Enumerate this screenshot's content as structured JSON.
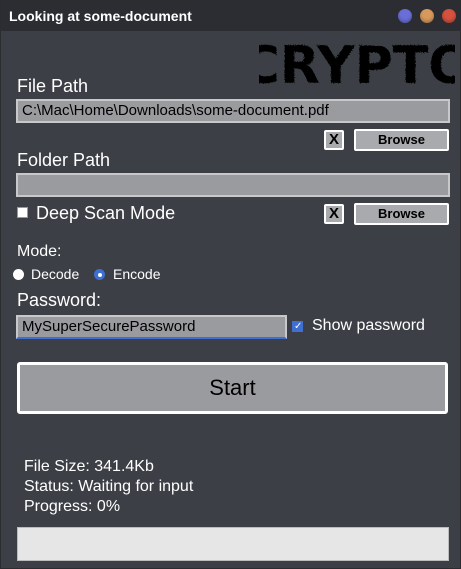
{
  "window": {
    "title": "Looking at some-document"
  },
  "logo": {
    "text": "CRYPTO"
  },
  "file_path": {
    "label": "File Path",
    "value": "C:\\Mac\\Home\\Downloads\\some-document.pdf",
    "clear_label": "X",
    "browse_label": "Browse"
  },
  "folder_path": {
    "label": "Folder Path",
    "value": "",
    "clear_label": "X",
    "browse_label": "Browse"
  },
  "deep_scan": {
    "label": "Deep Scan Mode",
    "checked": false
  },
  "mode": {
    "label": "Mode:",
    "options": [
      "Decode",
      "Encode"
    ],
    "selected": "Encode"
  },
  "password": {
    "label": "Password:",
    "value": "MySuperSecurePassword",
    "show_label": "Show password",
    "show_checked": true
  },
  "start_label": "Start",
  "info": {
    "file_size": "File Size: 341.4Kb",
    "status": "Status: Waiting for input",
    "progress_text": "Progress: 0%"
  },
  "progress": {
    "value_percent": 0
  },
  "colors": {
    "background": "#3c3f46",
    "accent": "#3f6fd0",
    "field": "#9a9b9f"
  }
}
